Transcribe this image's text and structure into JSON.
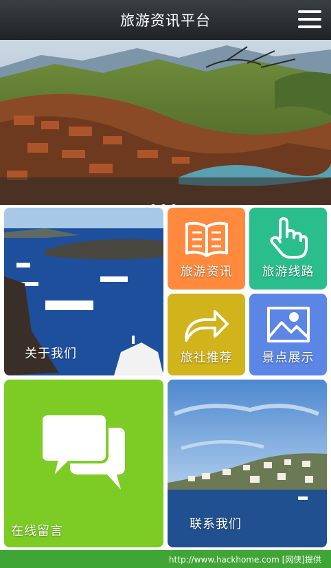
{
  "header": {
    "title": "旅游资讯平台"
  },
  "banner": {
    "slides": 3,
    "active_slide": 1
  },
  "tiles": {
    "about": {
      "label": "关于我们"
    },
    "news": {
      "label": "旅游资讯",
      "color": "#ff8a3d"
    },
    "routes": {
      "label": "旅游线路",
      "color": "#29be8c"
    },
    "agency": {
      "label": "旅社推荐",
      "color": "#d1b31b"
    },
    "scenic": {
      "label": "景点展示",
      "color": "#5b86e6"
    },
    "message": {
      "label": "在线留言",
      "color": "#7ccc25"
    },
    "contact": {
      "label": "联系我们"
    }
  },
  "watermark": "http://www.hackhome.com [网侠]提供",
  "colors": {
    "header": "#2b3034",
    "page_border": "#3fa535"
  },
  "icons": [
    "menu-icon",
    "book-icon",
    "hand-pointer-icon",
    "share-arrow-icon",
    "image-icon",
    "chat-bubbles-icon"
  ]
}
